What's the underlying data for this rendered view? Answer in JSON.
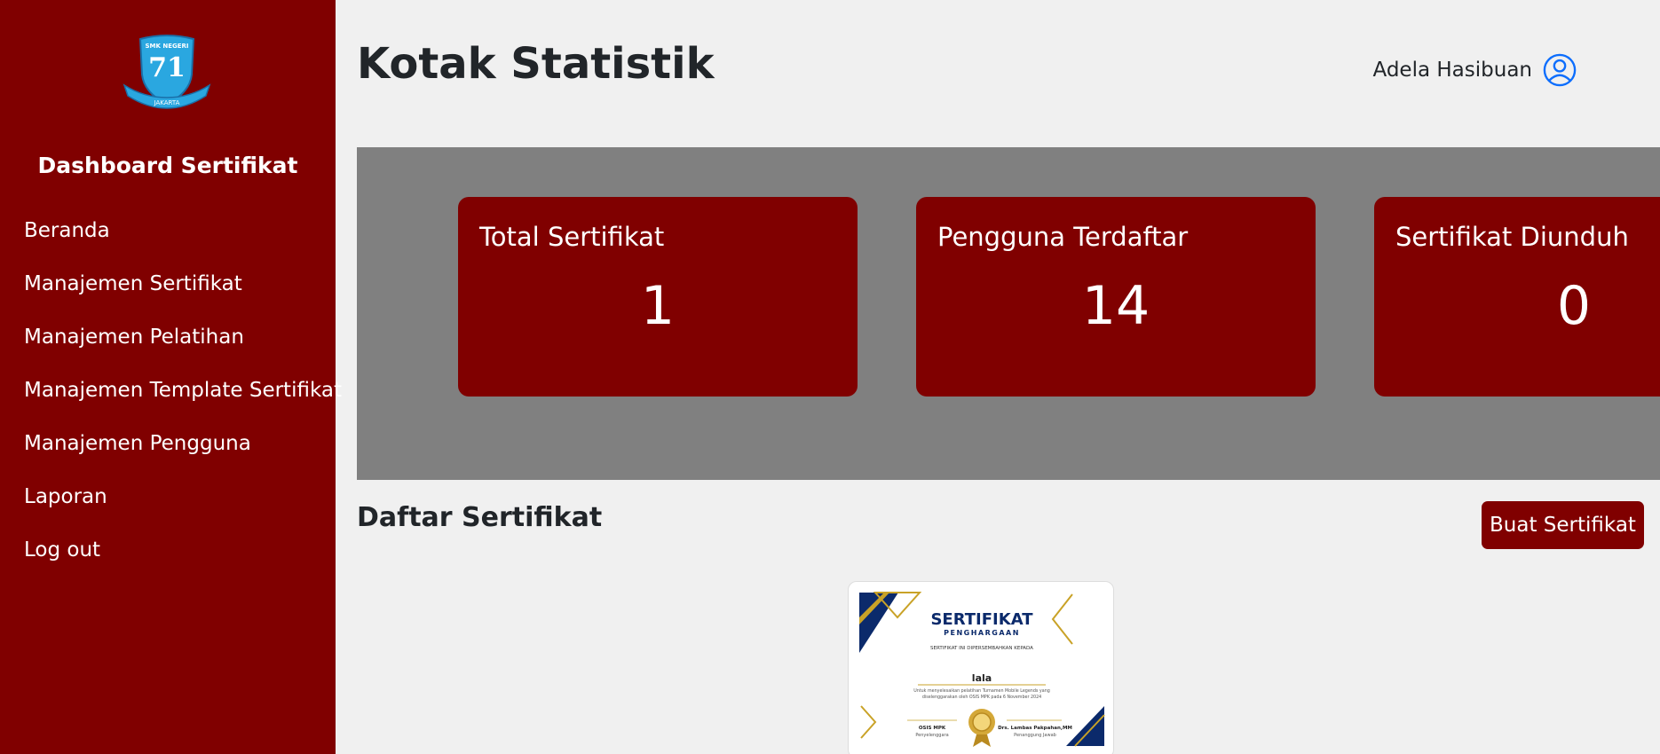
{
  "sidebar": {
    "logo": {
      "top_text": "SMK NEGERI",
      "number": "71",
      "ribbon_text": "JAKARTA"
    },
    "brand": "Dashboard Sertifikat",
    "items": [
      {
        "label": "Beranda"
      },
      {
        "label": "Manajemen Sertifikat"
      },
      {
        "label": "Manajemen Pelatihan"
      },
      {
        "label": "Manajemen Template Sertifikat"
      },
      {
        "label": "Manajemen Pengguna"
      },
      {
        "label": "Laporan"
      },
      {
        "label": "Log out"
      }
    ]
  },
  "header": {
    "title": "Kotak Statistik",
    "user_name": "Adela Hasibuan",
    "user_icon": "user-circle-icon"
  },
  "stats": [
    {
      "label": "Total Sertifikat",
      "value": "1"
    },
    {
      "label": "Pengguna Terdaftar",
      "value": "14"
    },
    {
      "label": "Sertifikat Diunduh",
      "value": "0"
    }
  ],
  "certificates": {
    "title": "Daftar Sertifikat",
    "create_button": "Buat Sertifikat",
    "items": [
      {
        "heading": "SERTIFIKAT",
        "subheading": "PENGHARGAAN",
        "dedication": "SERTIFIKAT INI DIPERSEMBAHKAN KEPADA",
        "recipient": "lala",
        "description_line1": "Untuk menyelesaikan pelatihan Turnamen Mobile Legends yang",
        "description_line2": "diselenggarakan oleh OSIS MPK pada 6 November 2024",
        "signer_left_name": "OSIS MPK",
        "signer_left_role": "Penyelenggara",
        "signer_right_name": "Drs. Lambas Pakpahan,MM",
        "signer_right_role": "Penanggung Jawab"
      }
    ]
  },
  "colors": {
    "primary": "#800000",
    "stats_bg": "#808080",
    "page_bg": "#f0f0f0",
    "user_icon": "#0d6efd",
    "logo": "#2aa7e0"
  }
}
